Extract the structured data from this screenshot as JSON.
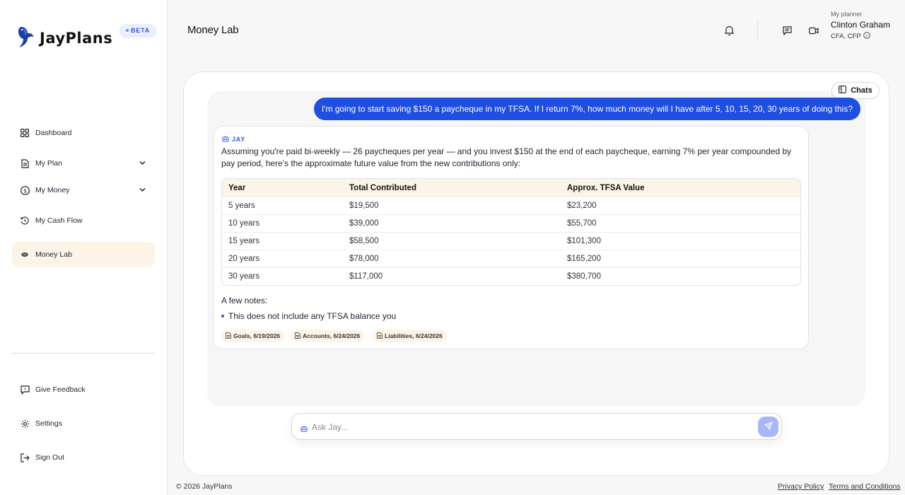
{
  "app": {
    "brand": "JayPlans",
    "badge": "BETA"
  },
  "sidebar": {
    "items": [
      {
        "label": "Dashboard"
      },
      {
        "label": "My Plan"
      },
      {
        "label": "My Money"
      },
      {
        "label": "My Cash Flow"
      },
      {
        "label": "Money Lab"
      }
    ],
    "bottom": [
      {
        "label": "Give Feedback"
      },
      {
        "label": "Settings"
      },
      {
        "label": "Sign Out"
      }
    ]
  },
  "header": {
    "title": "Money Lab",
    "planner_label": "My planner",
    "planner_name": "Clinton Graham",
    "planner_credentials": "CFA, CFP"
  },
  "chat": {
    "chats_button": "Chats",
    "user_message": "I'm going to start saving $150 a paycheque in my TFSA. If I return 7%, how much money will I have after 5, 10, 15, 20, 30 years of doing this?",
    "assistant_name": "JAY",
    "assistant_intro": "Assuming you're paid bi-weekly — 26 paycheques per year — and you invest $150 at the end of each paycheque, earning 7% per year compounded by pay period, here's the approximate future value from the new contributions only:",
    "table": {
      "headers": [
        "Year",
        "Total Contributed",
        "Approx. TFSA Value"
      ],
      "rows": [
        [
          "5 years",
          "$19,500",
          "$23,200"
        ],
        [
          "10 years",
          "$39,000",
          "$55,700"
        ],
        [
          "15 years",
          "$58,500",
          "$101,300"
        ],
        [
          "20 years",
          "$78,000",
          "$165,200"
        ],
        [
          "30 years",
          "$117,000",
          "$380,700"
        ]
      ]
    },
    "notes_title": "A few notes:",
    "notes": [
      "This does not include any TFSA balance you"
    ],
    "sources": [
      "Goals, 6/19/2026",
      "Accounts, 6/24/2026",
      "Liabilities, 6/24/2026"
    ]
  },
  "composer": {
    "placeholder": "Ask Jay..."
  },
  "footer": {
    "copyright": "© 2026 JayPlans",
    "privacy": "Privacy Policy",
    "terms": "Terms and Conditions"
  },
  "colors": {
    "accent": "#1f4fe0",
    "active_bg": "#fdf3e7",
    "badge": "#2f55e6"
  }
}
